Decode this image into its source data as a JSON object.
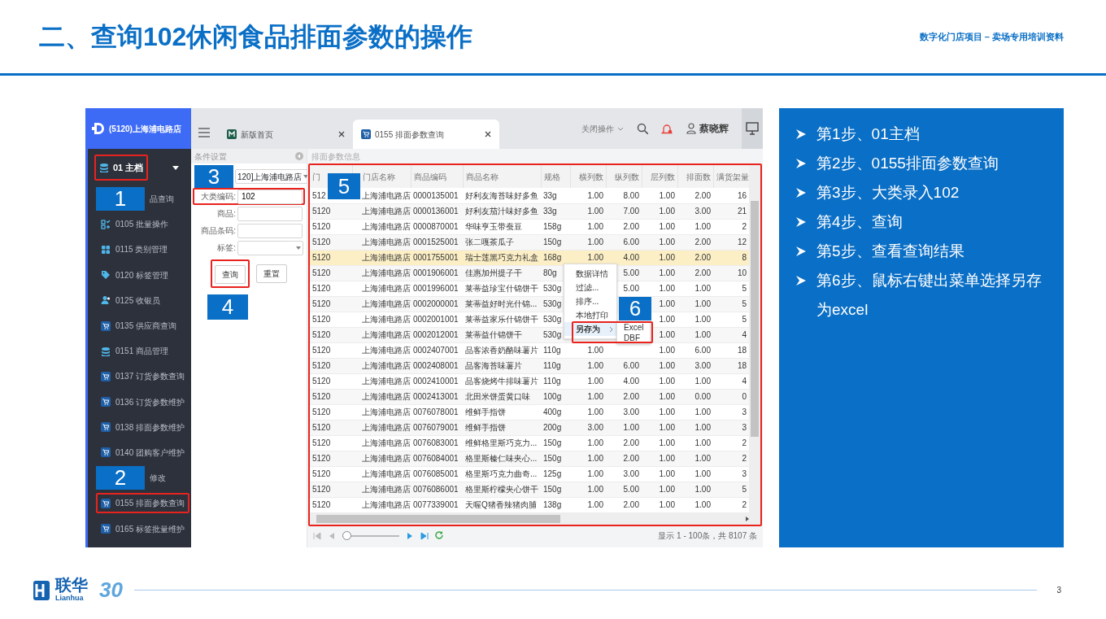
{
  "slide": {
    "title": "二、查询102休闲食品排面参数的操作",
    "subtitle": "数字化门店项目 – 卖场专用培训资料",
    "page_number": "3",
    "logo": {
      "name": "联华",
      "latin": "Lianhua",
      "anniversary": "30"
    }
  },
  "app": {
    "store_title": "(5120)上海浦电路店",
    "sidebar": {
      "group": {
        "label": "01 主档",
        "expanded": true,
        "highlighted": true
      },
      "items": [
        {
          "label": "品查询",
          "callout": "1",
          "highlighted": false
        },
        {
          "label": "0105 批量操作",
          "kind": "checklist",
          "highlighted": false
        },
        {
          "label": "0115 类别管理",
          "kind": "grid",
          "highlighted": false
        },
        {
          "label": "0120 标签管理",
          "kind": "tag",
          "highlighted": false
        },
        {
          "label": "0125 收银员",
          "kind": "user",
          "highlighted": false
        },
        {
          "label": "0135 供应商查询",
          "kind": "cart",
          "highlighted": false
        },
        {
          "label": "0151 商品管理",
          "kind": "database",
          "highlighted": false
        },
        {
          "label": "0137 订货参数查询",
          "kind": "cart",
          "highlighted": false
        },
        {
          "label": "0136 订货参数维护",
          "kind": "cart",
          "highlighted": false
        },
        {
          "label": "0138 排面参数维护",
          "kind": "cart",
          "highlighted": false
        },
        {
          "label": "0140 团购客户维护",
          "kind": "cart",
          "highlighted": false
        },
        {
          "label": "修改",
          "callout": "2",
          "highlighted": false
        },
        {
          "label": "0155 排面参数查询",
          "kind": "cart",
          "highlighted": true
        },
        {
          "label": "0165 标签批量维护",
          "kind": "cart",
          "highlighted": false
        }
      ]
    },
    "topbar": {
      "tabs": [
        {
          "label": "新版首页",
          "selected": false
        },
        {
          "label": "0155 排面参数查询",
          "selected": true
        }
      ],
      "close_menu": "关闭操作",
      "user": "蔡晓辉"
    },
    "conditions": {
      "title": "条件设置",
      "fields": [
        {
          "kind": "select",
          "value": "120]上海浦电路店",
          "callout": "3"
        },
        {
          "kind": "text",
          "label": "大类编码:",
          "value": "102",
          "highlighted": true
        },
        {
          "kind": "text",
          "label": "商品:",
          "highlighted": false
        },
        {
          "kind": "text",
          "label": "商品条码:",
          "highlighted": false
        },
        {
          "kind": "select",
          "label": "标签:",
          "highlighted": false
        }
      ],
      "buttons": [
        {
          "label": "查询",
          "highlighted": true
        },
        {
          "label": "重置",
          "highlighted": false
        }
      ],
      "callout": "4"
    },
    "table": {
      "title": "排面参数信息",
      "highlighted": true,
      "callout": "5",
      "columns": [
        "门",
        "门店名称",
        "商品编码",
        "商品名称",
        "规格",
        "横列数",
        "纵列数",
        "层列数",
        "排面数",
        "满货架量"
      ],
      "rows": [
        {
          "selected": false,
          "cells": [
            "512",
            "上海浦电路店",
            "0000135001",
            "好利友海苔味好多鱼",
            "33g",
            "1.00",
            "8.00",
            "1.00",
            "2.00",
            "16"
          ]
        },
        {
          "selected": false,
          "cells": [
            "5120",
            "上海浦电路店",
            "0000136001",
            "好利友茄汁味好多鱼",
            "33g",
            "1.00",
            "7.00",
            "1.00",
            "3.00",
            "21"
          ]
        },
        {
          "selected": false,
          "cells": [
            "5120",
            "上海浦电路店",
            "0000870001",
            "华味亨玉带蚕豆",
            "158g",
            "1.00",
            "2.00",
            "1.00",
            "1.00",
            "2"
          ]
        },
        {
          "selected": false,
          "cells": [
            "5120",
            "上海浦电路店",
            "0001525001",
            "张二嘎茶瓜子",
            "150g",
            "1.00",
            "6.00",
            "1.00",
            "2.00",
            "12"
          ]
        },
        {
          "selected": true,
          "cells": [
            "5120",
            "上海浦电路店",
            "0001755001",
            "瑞士莲黑巧克力礼盒",
            "168g",
            "1.00",
            "4.00",
            "1.00",
            "2.00",
            "8"
          ]
        },
        {
          "selected": false,
          "cells": [
            "5120",
            "上海浦电路店",
            "0001906001",
            "佳惠加州提子干",
            "80g",
            null,
            "5.00",
            "1.00",
            "2.00",
            "10"
          ]
        },
        {
          "selected": false,
          "cells": [
            "5120",
            "上海浦电路店",
            "0001996001",
            "莱蒂益珍宝什锦饼干",
            "530g",
            null,
            "5.00",
            "1.00",
            "1.00",
            "5"
          ]
        },
        {
          "selected": false,
          "cells": [
            "5120",
            "上海浦电路店",
            "0002000001",
            "莱蒂益好时光什锦...",
            "530g",
            null,
            null,
            "1.00",
            "1.00",
            "5"
          ]
        },
        {
          "selected": false,
          "cells": [
            "5120",
            "上海浦电路店",
            "0002001001",
            "莱蒂益家乐什锦饼干",
            "530g",
            null,
            null,
            "1.00",
            "1.00",
            "5"
          ]
        },
        {
          "selected": false,
          "cells": [
            "5120",
            "上海浦电路店",
            "0002012001",
            "莱蒂益什锦饼干",
            "530g",
            null,
            null,
            "1.00",
            "1.00",
            "4"
          ]
        },
        {
          "selected": false,
          "cells": [
            "5120",
            "上海浦电路店",
            "0002407001",
            "品客浓香奶酪味薯片",
            "110g",
            "1.00",
            null,
            "1.00",
            "6.00",
            "18"
          ]
        },
        {
          "selected": false,
          "cells": [
            "5120",
            "上海浦电路店",
            "0002408001",
            "品客海苔味薯片",
            "110g",
            "1.00",
            "6.00",
            "1.00",
            "3.00",
            "18"
          ]
        },
        {
          "selected": false,
          "cells": [
            "5120",
            "上海浦电路店",
            "0002410001",
            "品客烧烤牛排味薯片",
            "110g",
            "1.00",
            "4.00",
            "1.00",
            "1.00",
            "4"
          ]
        },
        {
          "selected": false,
          "cells": [
            "5120",
            "上海浦电路店",
            "0002413001",
            "北田米饼蛋黄口味",
            "100g",
            "1.00",
            "2.00",
            "1.00",
            "0.00",
            "0"
          ]
        },
        {
          "selected": false,
          "cells": [
            "5120",
            "上海浦电路店",
            "0076078001",
            "维鲜手指饼",
            "400g",
            "1.00",
            "3.00",
            "1.00",
            "1.00",
            "3"
          ]
        },
        {
          "selected": false,
          "cells": [
            "5120",
            "上海浦电路店",
            "0076079001",
            "维鲜手指饼",
            "200g",
            "3.00",
            "1.00",
            "1.00",
            "1.00",
            "3"
          ]
        },
        {
          "selected": false,
          "cells": [
            "5120",
            "上海浦电路店",
            "0076083001",
            "维鲜格里斯巧克力...",
            "150g",
            "1.00",
            "2.00",
            "1.00",
            "1.00",
            "2"
          ]
        },
        {
          "selected": false,
          "cells": [
            "5120",
            "上海浦电路店",
            "0076084001",
            "格里斯榛仁味夹心...",
            "150g",
            "1.00",
            "2.00",
            "1.00",
            "1.00",
            "2"
          ]
        },
        {
          "selected": false,
          "cells": [
            "5120",
            "上海浦电路店",
            "0076085001",
            "格里斯巧克力曲奇...",
            "125g",
            "1.00",
            "3.00",
            "1.00",
            "1.00",
            "3"
          ]
        },
        {
          "selected": false,
          "cells": [
            "5120",
            "上海浦电路店",
            "0076086001",
            "格里斯柠檬夹心饼干",
            "150g",
            "1.00",
            "5.00",
            "1.00",
            "1.00",
            "5"
          ]
        },
        {
          "selected": false,
          "cells": [
            "5120",
            "上海浦电路店",
            "0077339001",
            "天喔Q猪香辣猪肉脯",
            "138g",
            "1.00",
            "2.00",
            "1.00",
            "1.00",
            "2"
          ]
        }
      ]
    },
    "context_menu": {
      "callout": "6",
      "items": [
        {
          "label": "数据详情",
          "hovered": false
        },
        {
          "label": "过滤...",
          "hovered": false
        },
        {
          "label": "排序...",
          "hovered": false
        },
        {
          "label": "本地打印",
          "hovered": false
        },
        {
          "label": "另存为",
          "has_submenu": true,
          "hovered": true,
          "highlighted": true
        }
      ],
      "submenu": [
        "Excel",
        "DBF"
      ]
    },
    "pager": {
      "level": 0,
      "status": "显示 1 - 100条，共 8107 条"
    }
  },
  "steps": [
    "第1步、01主档",
    "第2步、0155排面参数查询",
    "第3步、大类录入102",
    "第4步、查询",
    "第5步、查看查询结果",
    "第6步、鼠标右键出菜单选择另存为excel"
  ]
}
